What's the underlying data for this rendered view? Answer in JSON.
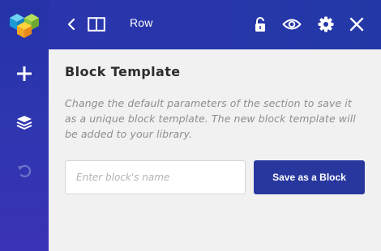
{
  "sidebar": {
    "logo": "cubes-logo-icon",
    "items": [
      {
        "icon": "plus-icon",
        "name": "add"
      },
      {
        "icon": "layers-icon",
        "name": "layers"
      },
      {
        "icon": "undo-icon",
        "name": "undo"
      }
    ]
  },
  "toolbar": {
    "title": "Row",
    "icons": [
      "back-icon",
      "column-layout-icon",
      "lock-icon",
      "eye-icon",
      "gear-icon",
      "close-icon"
    ]
  },
  "panel": {
    "heading": "Block Template",
    "description": "Change the default parameters of the section to save it as a unique block template. The new block template will be added to your library.",
    "name_input": {
      "value": "",
      "placeholder": "Enter block's name"
    },
    "save_label": "Save as a Block"
  },
  "colors": {
    "rail": "#2f36b0",
    "topbar": "#2b35ad",
    "accent": "#28379e",
    "background": "#f1f1f1"
  }
}
